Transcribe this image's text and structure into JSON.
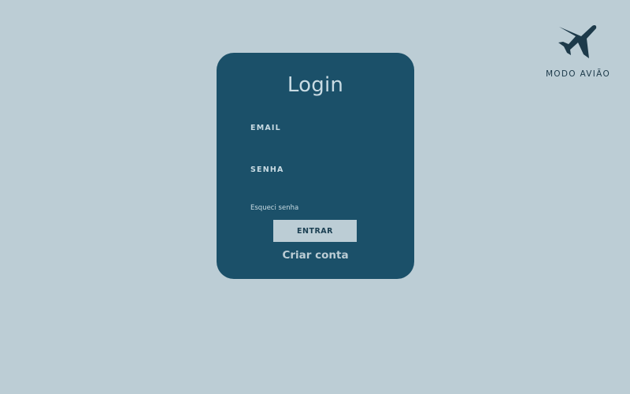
{
  "brand": {
    "name": "MODO AVIÃO",
    "logo_icon": "airplane-icon",
    "color": "#1d3a4a"
  },
  "login": {
    "title": "Login",
    "email_label": "EMAIL",
    "email_value": "",
    "password_label": "SENHA",
    "password_value": "",
    "forgot_password": "Esqueci senha",
    "submit_label": "ENTRAR",
    "create_account": "Criar conta"
  },
  "colors": {
    "background": "#bccdd5",
    "card": "#1b5069",
    "text_light": "#c9dbe3"
  }
}
